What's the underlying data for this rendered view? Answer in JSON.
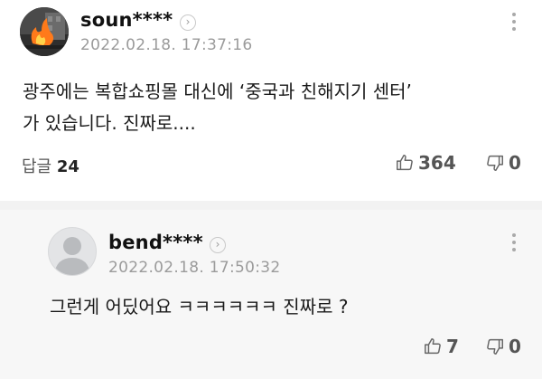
{
  "comment": {
    "username": "soun****",
    "timestamp": "2022.02.18. 17:37:16",
    "text_line1": "광주에는 복합쇼핑몰 대신에 ‘중국과 친해지기 센터’",
    "text_line2": "가 있습니다. 진짜로....",
    "reply_label": "답글",
    "reply_count": "24",
    "likes": "364",
    "dislikes": "0"
  },
  "reply": {
    "username": "bend****",
    "timestamp": "2022.02.18. 17:50:32",
    "text": "그런게 어딨어요 ㅋㅋㅋㅋㅋㅋ 진짜로 ?",
    "likes": "7",
    "dislikes": "0"
  },
  "icons": {
    "profile_chevron": "chevron-right-icon",
    "more": "more-vertical-icon",
    "like": "thumbs-up-icon",
    "dislike": "thumbs-down-icon",
    "default_avatar": "person-silhouette-icon"
  },
  "colors": {
    "separator": "#f2f2f2",
    "reply_background": "#f7f7f7",
    "muted_text": "#9b9b9b"
  }
}
